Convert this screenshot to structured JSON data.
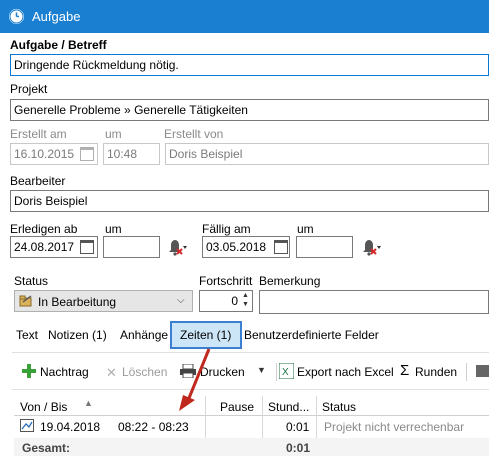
{
  "window": {
    "title": "Aufgabe"
  },
  "form": {
    "betreff_label": "Aufgabe / Betreff",
    "betreff_value": "Dringende Rückmeldung nötig.",
    "projekt_label": "Projekt",
    "projekt_value": "Generelle Probleme » Generelle Tätigkeiten",
    "erstellt_am_label": "Erstellt am",
    "erstellt_um_label": "um",
    "erstellt_von_label": "Erstellt von",
    "erstellt_am_value": "16.10.2015",
    "erstellt_um_value": "10:48",
    "erstellt_von_value": "Doris Beispiel",
    "bearbeiter_label": "Bearbeiter",
    "bearbeiter_value": "Doris Beispiel",
    "erledigen_ab_label": "Erledigen ab",
    "erledigen_um_label": "um",
    "faellig_am_label": "Fällig am",
    "faellig_um_label": "um",
    "erledigen_ab_value": "24.08.2017",
    "erledigen_um_value": "",
    "faellig_am_value": "03.05.2018",
    "faellig_um_value": "",
    "status_label": "Status",
    "status_value": "In Bearbeitung",
    "fortschritt_label": "Fortschritt",
    "fortschritt_value": "0",
    "bemerkung_label": "Bemerkung",
    "bemerkung_value": ""
  },
  "tabs": [
    {
      "label": "Text"
    },
    {
      "label": "Notizen (1)"
    },
    {
      "label": "Anhänge"
    },
    {
      "label": "Zeiten (1)"
    },
    {
      "label": "Benutzerdefinierte Felder"
    }
  ],
  "toolbar": {
    "nachtrag": "Nachtrag",
    "loeschen": "Löschen",
    "drucken": "Drucken",
    "export": "Export nach Excel",
    "runden": "Runden"
  },
  "grid": {
    "headers": {
      "von_bis": "Von / Bis",
      "pause": "Pause",
      "stunden": "Stund...",
      "status": "Status"
    },
    "row": {
      "date": "19.04.2018",
      "time": "08:22 - 08:23",
      "stunden": "0:01",
      "status": "Projekt nicht verrechenbar"
    },
    "total": {
      "label": "Gesamt:",
      "stunden": "0:01"
    }
  },
  "colors": {
    "titlebar": "#1a7fd1",
    "accent": "#0b78d7",
    "annotation": "#c0281e"
  }
}
